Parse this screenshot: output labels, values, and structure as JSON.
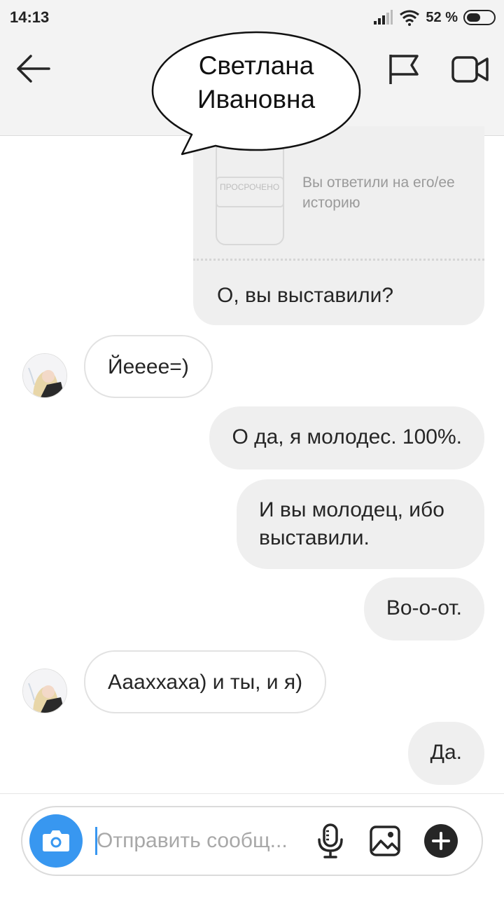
{
  "status_bar": {
    "time": "14:13",
    "battery_percent": "52 %",
    "battery_level": 0.52
  },
  "header": {
    "contact_name_line1": "Светлана",
    "contact_name_line2": "Ивановна",
    "icons": {
      "back": "arrow-left-icon",
      "flag": "flag-icon",
      "video": "video-call-icon"
    }
  },
  "messages": {
    "story_reply": {
      "status_label": "ПРОСРОЧЕНО",
      "note": "Вы ответили на его/ее историю",
      "text": "О, вы выставили?"
    },
    "m1": {
      "text": "Йееее=)"
    },
    "m2": {
      "text": "О да, я молодес. 100%."
    },
    "m3": {
      "text": "И вы молодец, ибо выставили."
    },
    "m4": {
      "text": "Во-о-от."
    },
    "m5": {
      "text": "Аааххаха) и ты, и я)"
    },
    "m6": {
      "text": "Да."
    }
  },
  "composer": {
    "placeholder": "Отправить сообщ...",
    "value": "",
    "icons": {
      "camera": "camera-icon",
      "mic": "microphone-icon",
      "gallery": "image-icon",
      "plus": "plus-icon"
    }
  },
  "colors": {
    "accent": "#3897f0",
    "outgoing_bubble": "#efefef",
    "incoming_border": "#e2e2e2",
    "header_bg": "#f3f3f3"
  }
}
